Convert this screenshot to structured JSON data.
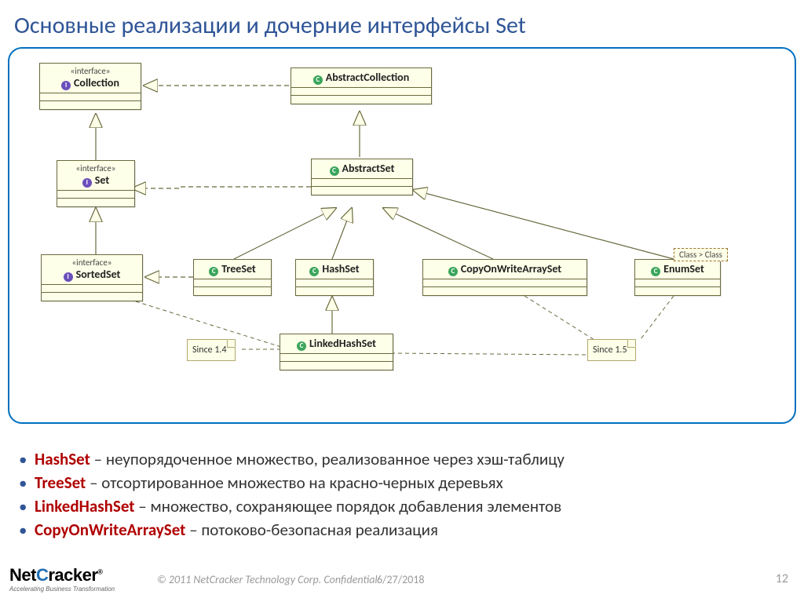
{
  "title": "Основные реализации и дочерние интерфейсы Set",
  "nodes": {
    "collection": {
      "stereotype": "«interface»",
      "name": "Collection",
      "icon": "I"
    },
    "set": {
      "stereotype": "«interface»",
      "name": "Set",
      "icon": "I"
    },
    "sortedset": {
      "stereotype": "«interface»",
      "name": "SortedSet",
      "icon": "I"
    },
    "abstractcollection": {
      "name": "AbstractCollection",
      "icon": "C"
    },
    "abstractset": {
      "name": "AbstractSet",
      "icon": "C"
    },
    "treeset": {
      "name": "TreeSet",
      "icon": "C"
    },
    "hashset": {
      "name": "HashSet",
      "icon": "C"
    },
    "copyonwrite": {
      "name": "CopyOnWriteArraySet",
      "icon": "C"
    },
    "enumset": {
      "name": "EnumSet",
      "icon": "C"
    },
    "linkedhashset": {
      "name": "LinkedHashSet",
      "icon": "C"
    }
  },
  "notes": {
    "since14": "Since 1.4",
    "since15": "Since 1.5"
  },
  "typeparam": "Class > Class",
  "bullets": [
    {
      "term": "HashSet",
      "desc": " – неупорядоченное множество, реализованное через хэш-таблицу"
    },
    {
      "term": "TreeSet",
      "desc": " – отсортированное множество на красно-черных деревьях"
    },
    {
      "term": "LinkedHashSet",
      "desc": " – множество, сохраняющее порядок добавления элементов"
    },
    {
      "term": "CopyOnWriteArraySet",
      "desc": " – потоково-безопасная реализация"
    }
  ],
  "footer": {
    "brand_pre": "Net",
    "brand_c": "C",
    "brand_post": "racker",
    "reg": "®",
    "tagline": "Accelerating Business Transformation",
    "copyright": "© 2011 NetCracker Technology Corp. Confidential.",
    "date": "6/27/2018",
    "page": "12"
  }
}
